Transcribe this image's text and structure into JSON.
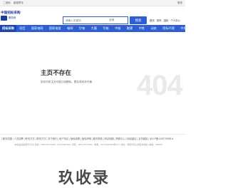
{
  "topbar": {
    "links_left": [
      "二维码",
      "客服帮手"
    ],
    "link_right": "登录"
  },
  "header": {
    "logo_text": "中国招标采购",
    "logo_sub": "服务网",
    "search_placeholder": "请输入关键词",
    "search_scope": "全网",
    "search_button": "搜索",
    "links": [
      "首页",
      "发布",
      "招标",
      "个人中心"
    ]
  },
  "nav": {
    "first": "招标采购",
    "items": [
      "项目",
      "国家电网",
      "国家电投",
      "电网",
      "华电",
      "大唐",
      "华能",
      "中核",
      "能建",
      "中铁",
      "动态",
      "招标代理",
      "中标"
    ]
  },
  "error": {
    "title": "主页不存在",
    "description": "您访问的主页可能已经删除、更名或尚未开通",
    "code": "404"
  },
  "footer": {
    "links": "| 服务范围 | 人员招聘 | 联系方式 | 联系方式 | 关于我们 | 用户协议 | 隐私政策 | 版权声明 | 服务条款 | 网站地图 | 帮助中心 | 网站建议 | 友情链接 | 京ICP备10057755号-6",
    "info": "(本站是招采服务平台) 热线：0851-87719255 | 010-53387000 | 传真：0851-87719252 | 客服：010-53387000转210 | 地址：贵阳市观山湖区林城路 | 邮编：550081"
  },
  "watermark": "玖收录"
}
